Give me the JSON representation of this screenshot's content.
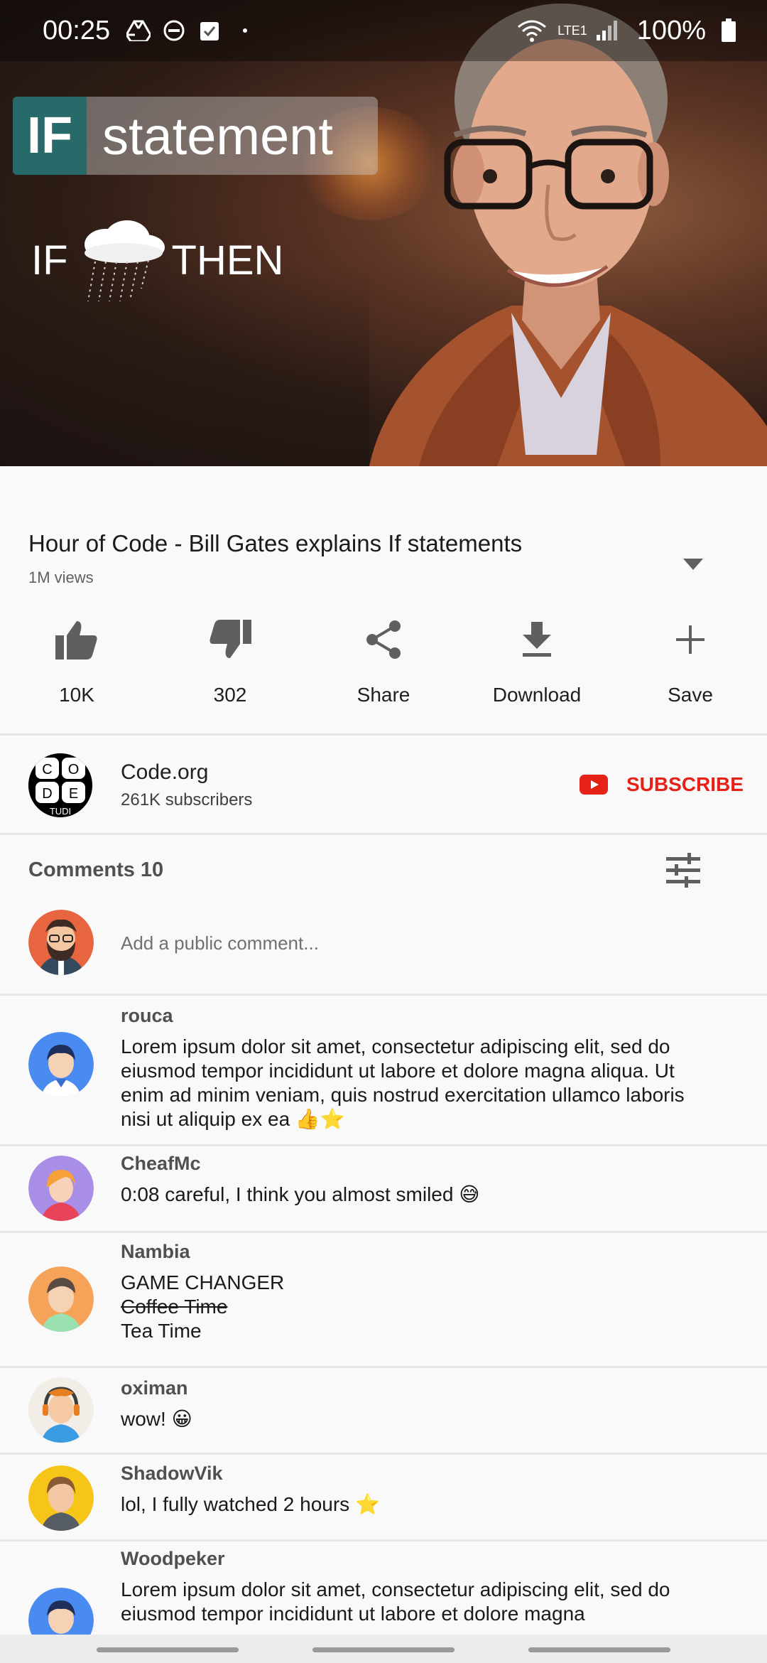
{
  "status_bar": {
    "time": "00:25",
    "network_label": "LTE1",
    "battery": "100%"
  },
  "video": {
    "badge_if": "IF",
    "badge_statement": "statement",
    "if_word": "IF",
    "then_word": "THEN"
  },
  "info": {
    "title": "Hour of Code - Bill Gates explains If statements",
    "views": "1M views"
  },
  "actions": [
    {
      "label": "10K",
      "icon": "thumb-up-icon"
    },
    {
      "label": "302",
      "icon": "thumb-down-icon"
    },
    {
      "label": "Share",
      "icon": "share-icon"
    },
    {
      "label": "Download",
      "icon": "download-icon"
    },
    {
      "label": "Save",
      "icon": "plus-icon"
    }
  ],
  "channel": {
    "logo_letters": [
      "C",
      "O",
      "D",
      "E"
    ],
    "logo_bottom": "TUDI",
    "name": "Code.org",
    "subscribers": "261K subscribers",
    "subscribe_label": "SUBSCRIBE"
  },
  "comments": {
    "header": "Comments 10",
    "add_placeholder": "Add a public comment...",
    "items": [
      {
        "author": "rouca",
        "lines": [
          "Lorem ipsum dolor sit amet, consectetur adipiscing elit, sed do eiusmod tempor incididunt ut labore et dolore magna aliqua. Ut enim ad minim veniam, quis nostrud exercitation ullamco laboris nisi ut aliquip ex ea 👍⭐"
        ]
      },
      {
        "author": "CheafMc",
        "lines": [
          "0:08 careful, I think you almost smiled 😅"
        ]
      },
      {
        "author": "Nambia",
        "lines": [
          "GAME CHANGER",
          "Coffee Time",
          "Tea Time"
        ]
      },
      {
        "author": "oximan",
        "lines": [
          "wow! 😀"
        ]
      },
      {
        "author": "ShadowVik",
        "lines": [
          "lol, I fully watched 2 hours ⭐"
        ]
      },
      {
        "author": "Woodpeker",
        "lines": [
          "Lorem ipsum dolor sit amet, consectetur adipiscing elit, sed do eiusmod tempor incididunt ut labore et dolore magna"
        ]
      }
    ]
  },
  "colors": {
    "subscribe_red": "#e62117",
    "badge_teal": "#287878"
  }
}
